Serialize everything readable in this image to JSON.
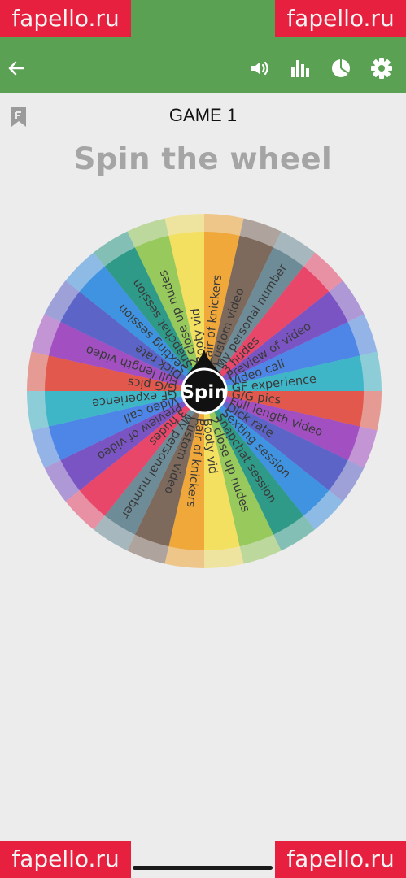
{
  "watermark": {
    "top_left": "fapello.ru",
    "top_right": "fapello.ru",
    "bottom_left": "fapello.ru",
    "bottom_right": "fapello.ru"
  },
  "app_bar": {
    "back_icon": "arrow-left-icon",
    "actions": [
      "volume-icon",
      "stats-icon",
      "pie-chart-icon",
      "gear-icon"
    ]
  },
  "game": {
    "title": "GAME 1",
    "headline": "Spin the wheel",
    "spin_label": "Spin"
  },
  "wheel": {
    "segments": [
      {
        "label": "Pair of knickers",
        "color": "#f0a83a"
      },
      {
        "label": "Custom video",
        "color": "#7e6a5d"
      },
      {
        "label": "My personal number",
        "color": "#6e8c98"
      },
      {
        "label": "3 nudes",
        "color": "#e8476a"
      },
      {
        "label": "Preview of video",
        "color": "#7b54c4"
      },
      {
        "label": "Video call",
        "color": "#4d86e6"
      },
      {
        "label": "GF experience",
        "color": "#3fb5c8"
      },
      {
        "label": "G/G pics",
        "color": "#e2584d"
      },
      {
        "label": "Full length video",
        "color": "#a24fc2"
      },
      {
        "label": "Dick rate",
        "color": "#5c64c8"
      },
      {
        "label": "Sexting session",
        "color": "#3f93e0"
      },
      {
        "label": "Snapchat session",
        "color": "#2f9a88"
      },
      {
        "label": "2 close up nudes",
        "color": "#97c95c"
      },
      {
        "label": "Booty vid",
        "color": "#f3df60"
      },
      {
        "label": "Pair of knickers",
        "color": "#f0a83a"
      },
      {
        "label": "Custom video",
        "color": "#7e6a5d"
      },
      {
        "label": "My personal number",
        "color": "#6e8c98"
      },
      {
        "label": "3 nudes",
        "color": "#e8476a"
      },
      {
        "label": "Preview of video",
        "color": "#7b54c4"
      },
      {
        "label": "Video call",
        "color": "#4d86e6"
      },
      {
        "label": "GF experience",
        "color": "#3fb5c8"
      },
      {
        "label": "G/G pics",
        "color": "#e2584d"
      },
      {
        "label": "Full length video",
        "color": "#a24fc2"
      },
      {
        "label": "Dick rate",
        "color": "#5c64c8"
      },
      {
        "label": "Sexting session",
        "color": "#3f93e0"
      },
      {
        "label": "Snapchat session",
        "color": "#2f9a88"
      },
      {
        "label": "2 close up nudes",
        "color": "#97c95c"
      },
      {
        "label": "Booty vid",
        "color": "#f3df60"
      }
    ]
  },
  "theme": {
    "app_bar": "#5aa153",
    "background": "#ececec",
    "watermark_bg": "#e8203f"
  }
}
